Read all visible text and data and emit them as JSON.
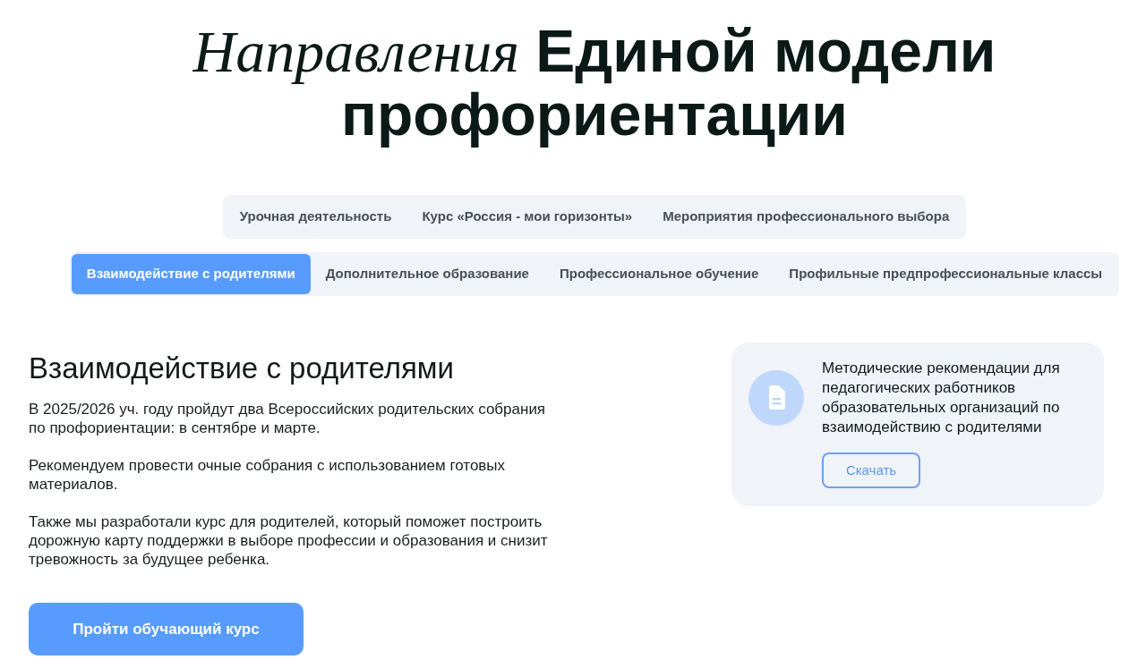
{
  "heading": "*Направления* Единой модели профориентации",
  "tab_rows": [
    {
      "tabs": [
        {
          "label": "Урочная деятельность",
          "selected": false
        },
        {
          "label": "Курс «Россия - мои горизонты»",
          "selected": false
        },
        {
          "label": "Мероприятия профессионального выбора",
          "selected": false
        }
      ]
    },
    {
      "tabs": [
        {
          "label": "Взаимодействие с родителями",
          "selected": true
        },
        {
          "label": "Дополнительное образование",
          "selected": false
        },
        {
          "label": "Профессиональное обучение",
          "selected": false
        },
        {
          "label": "Профильные предпрофессиональные классы",
          "selected": false
        }
      ]
    }
  ],
  "section": {
    "title": "Взаимодействие с родителями",
    "paragraphs": [
      "В 2025/2026 уч. году пройдут два Всероссийских родительских собрания по профориентации: в сентябре и марте.",
      "Рекомендуем провести очные собрания с использованием готовых материалов.",
      "Также мы разработали курс для родителей, который поможет построить дорожную карту поддержки в выборе профессии и образования и снизит тревожность за будущее ребенка."
    ],
    "button": "Пройти обучающий курс"
  },
  "resource_card": {
    "text": "Методические рекомендации для педагогических работников образовательных организаций по взаимодействию с родителями",
    "button": "Скачать"
  }
}
